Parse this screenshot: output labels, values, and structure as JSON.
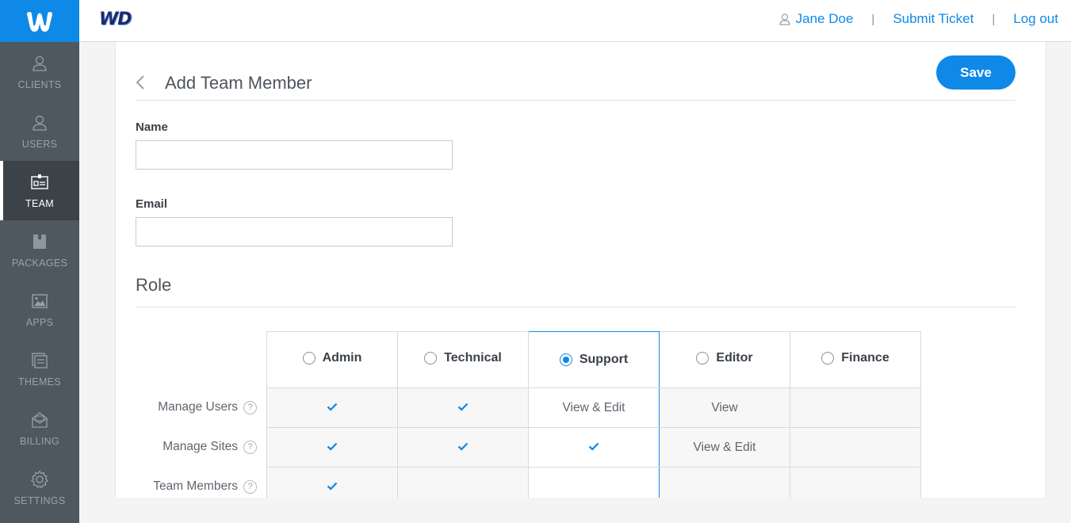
{
  "app": {
    "brand_icon": "weebly-w-logo",
    "brand_text": "WD"
  },
  "colors": {
    "accent": "#0f89e7",
    "sidebar": "#50585f",
    "sidebar_active": "#3b4248"
  },
  "sidebar": {
    "items": [
      {
        "label": "CLIENTS",
        "icon": "person-icon",
        "active": false
      },
      {
        "label": "USERS",
        "icon": "person-icon",
        "active": false
      },
      {
        "label": "TEAM",
        "icon": "id-card-icon",
        "active": true
      },
      {
        "label": "PACKAGES",
        "icon": "package-icon",
        "active": false
      },
      {
        "label": "APPS",
        "icon": "image-icon",
        "active": false
      },
      {
        "label": "THEMES",
        "icon": "themes-icon",
        "active": false
      },
      {
        "label": "BILLING",
        "icon": "envelope-icon",
        "active": false
      },
      {
        "label": "SETTINGS",
        "icon": "gear-icon",
        "active": false
      }
    ]
  },
  "topnav": {
    "user": "Jane Doe",
    "ticket": "Submit Ticket",
    "logout": "Log out",
    "separator": "|"
  },
  "page": {
    "title": "Add Team Member",
    "save_label": "Save"
  },
  "form": {
    "name_label": "Name",
    "name_value": "",
    "email_label": "Email",
    "email_value": ""
  },
  "role": {
    "title": "Role",
    "selected": "Support",
    "columns": [
      "Admin",
      "Technical",
      "Support",
      "Editor",
      "Finance"
    ],
    "rows": [
      {
        "label": "Manage Users",
        "cells": [
          "check",
          "check",
          "View & Edit",
          "View",
          ""
        ]
      },
      {
        "label": "Manage Sites",
        "cells": [
          "check",
          "check",
          "check",
          "View & Edit",
          ""
        ]
      },
      {
        "label": "Team Members",
        "cells": [
          "check",
          "",
          "",
          "",
          ""
        ]
      }
    ],
    "help_glyph": "?"
  }
}
